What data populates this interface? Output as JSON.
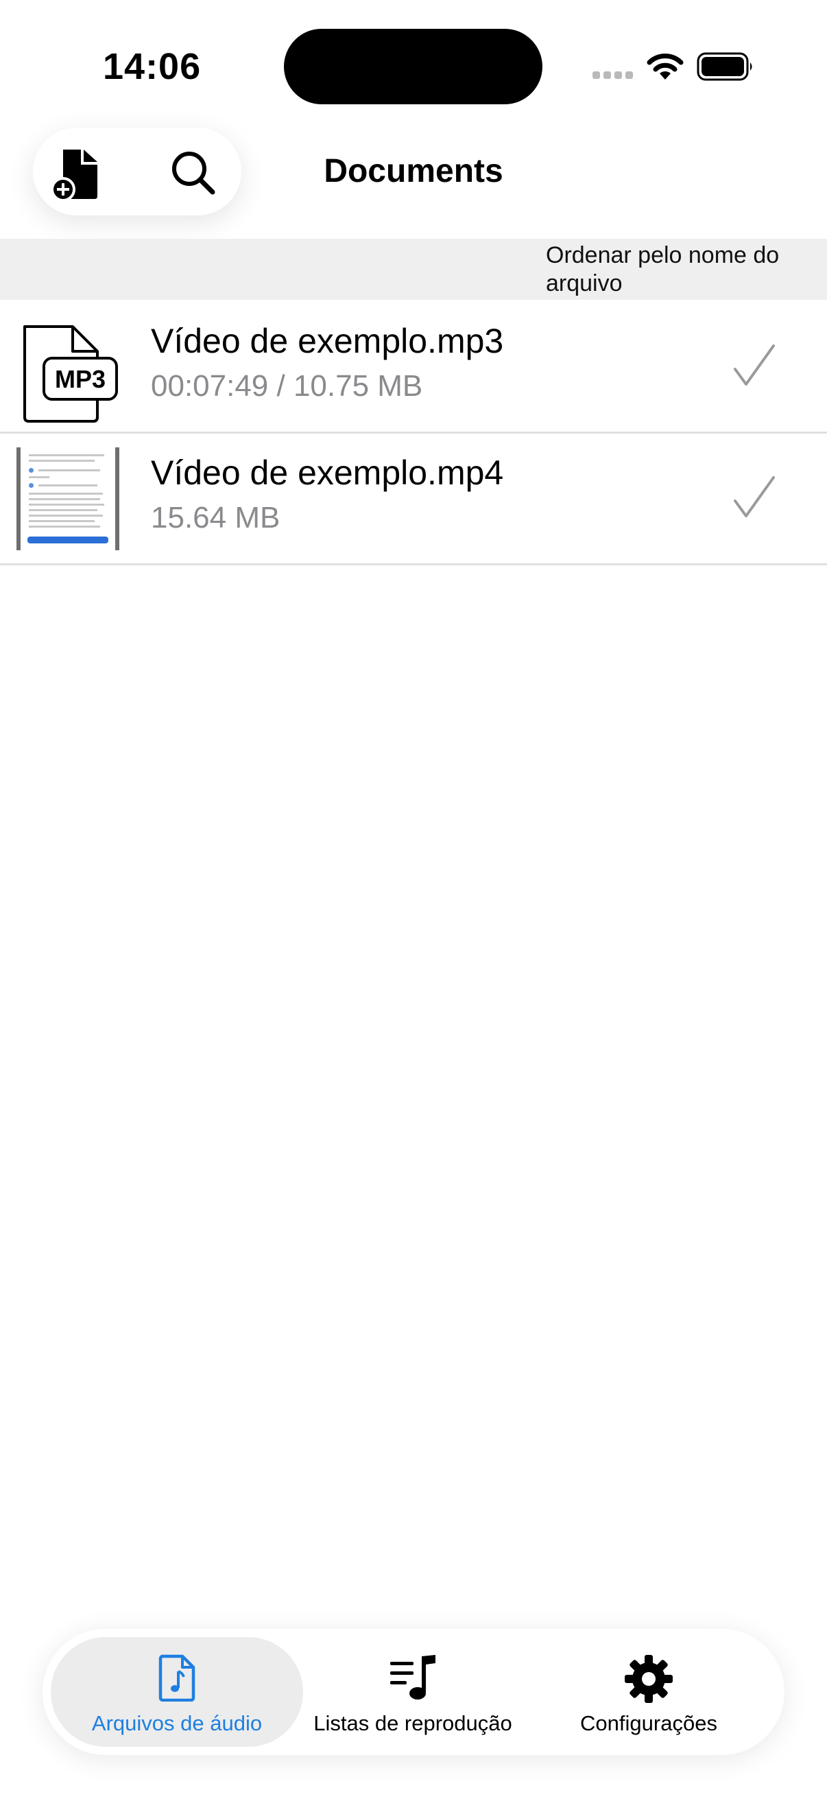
{
  "status_bar": {
    "time": "14:06"
  },
  "header": {
    "title": "Documents",
    "icons": {
      "add": "add-document-icon",
      "search": "search-icon"
    }
  },
  "sort": {
    "label": "Ordenar pelo nome do arquivo"
  },
  "files": [
    {
      "name": "Vídeo de exemplo.mp3",
      "meta": "00:07:49 / 10.75 MB",
      "thumbnail": "mp3-file-icon",
      "thumb_label": "MP3"
    },
    {
      "name": "Vídeo de exemplo.mp4",
      "meta": "15.64 MB",
      "thumbnail": "video-thumbnail"
    }
  ],
  "tab_bar": {
    "tabs": [
      {
        "label": "Arquivos de áudio",
        "icon": "audio-file-icon",
        "active": true
      },
      {
        "label": "Listas de reprodução",
        "icon": "playlist-icon",
        "active": false
      },
      {
        "label": "Configurações",
        "icon": "gear-icon",
        "active": false
      }
    ]
  },
  "colors": {
    "accent": "#1e7fe0",
    "secondary_text": "#8a8a8e",
    "sort_bar_bg": "#efefef",
    "active_tab_bg": "#ececec"
  }
}
